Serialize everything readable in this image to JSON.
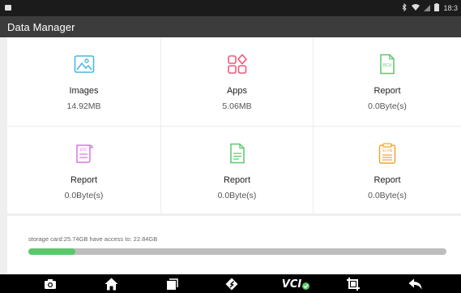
{
  "status_bar": {
    "time": "18:3",
    "icons": [
      "notification-icon",
      "bluetooth-icon",
      "wifi-icon",
      "signal-icon",
      "battery-icon"
    ]
  },
  "app_title": "Data Manager",
  "categories": [
    {
      "label": "Images",
      "size": "14.92MB",
      "icon": "image-icon",
      "color": "#4fb6e2"
    },
    {
      "label": "Apps",
      "size": "5.06MB",
      "icon": "apps-icon",
      "color": "#ee5a7a"
    },
    {
      "label": "Report",
      "size": "0.0Byte(s)",
      "icon": "ecu-report-icon",
      "icon_text": "ECU",
      "color": "#5ac86a"
    },
    {
      "label": "Report",
      "size": "0.0Byte(s)",
      "icon": "dtc-report-icon",
      "icon_text": "DTC",
      "color": "#d577e0"
    },
    {
      "label": "Report",
      "size": "0.0Byte(s)",
      "icon": "document-report-icon",
      "color": "#5ac86a"
    },
    {
      "label": "Report",
      "size": "0.0Byte(s)",
      "icon": "scan-report-icon",
      "icon_text": "SCAN",
      "color": "#f1a630"
    }
  ],
  "storage": {
    "text": "storage card:25.74GB have access to: 22.84GB",
    "used_fraction": 0.113,
    "fill_color": "#5ac86a"
  },
  "nav_bar": {
    "vci_label": "VCI",
    "buttons": [
      "camera-icon",
      "home-icon",
      "recent-apps-icon",
      "repair-icon",
      "vci-icon",
      "screenshot-icon",
      "back-icon"
    ]
  }
}
